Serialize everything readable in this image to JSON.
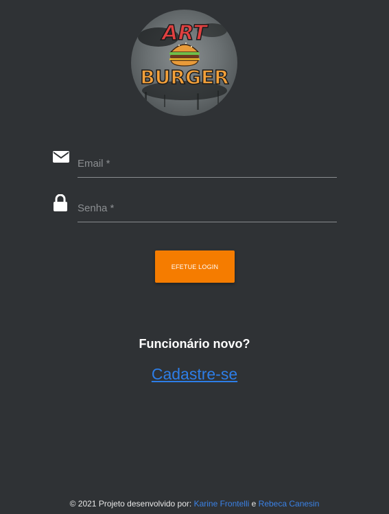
{
  "logo": {
    "line1": "ART",
    "line2": "BURGER"
  },
  "form": {
    "email_placeholder": "Email *",
    "password_placeholder": "Senha *",
    "login_label": "EFETUE LOGIN"
  },
  "signup": {
    "question": "Funcionário novo?",
    "link_label": "Cadastre-se"
  },
  "footer": {
    "prefix": "© 2021 Projeto desenvolvido por:",
    "author1": "Karine Frontelli",
    "conjunction": "e",
    "author2": "Rebeca Canesin"
  },
  "colors": {
    "background": "#2f3235",
    "accent": "#f57c00",
    "link": "#2d7ee8"
  }
}
